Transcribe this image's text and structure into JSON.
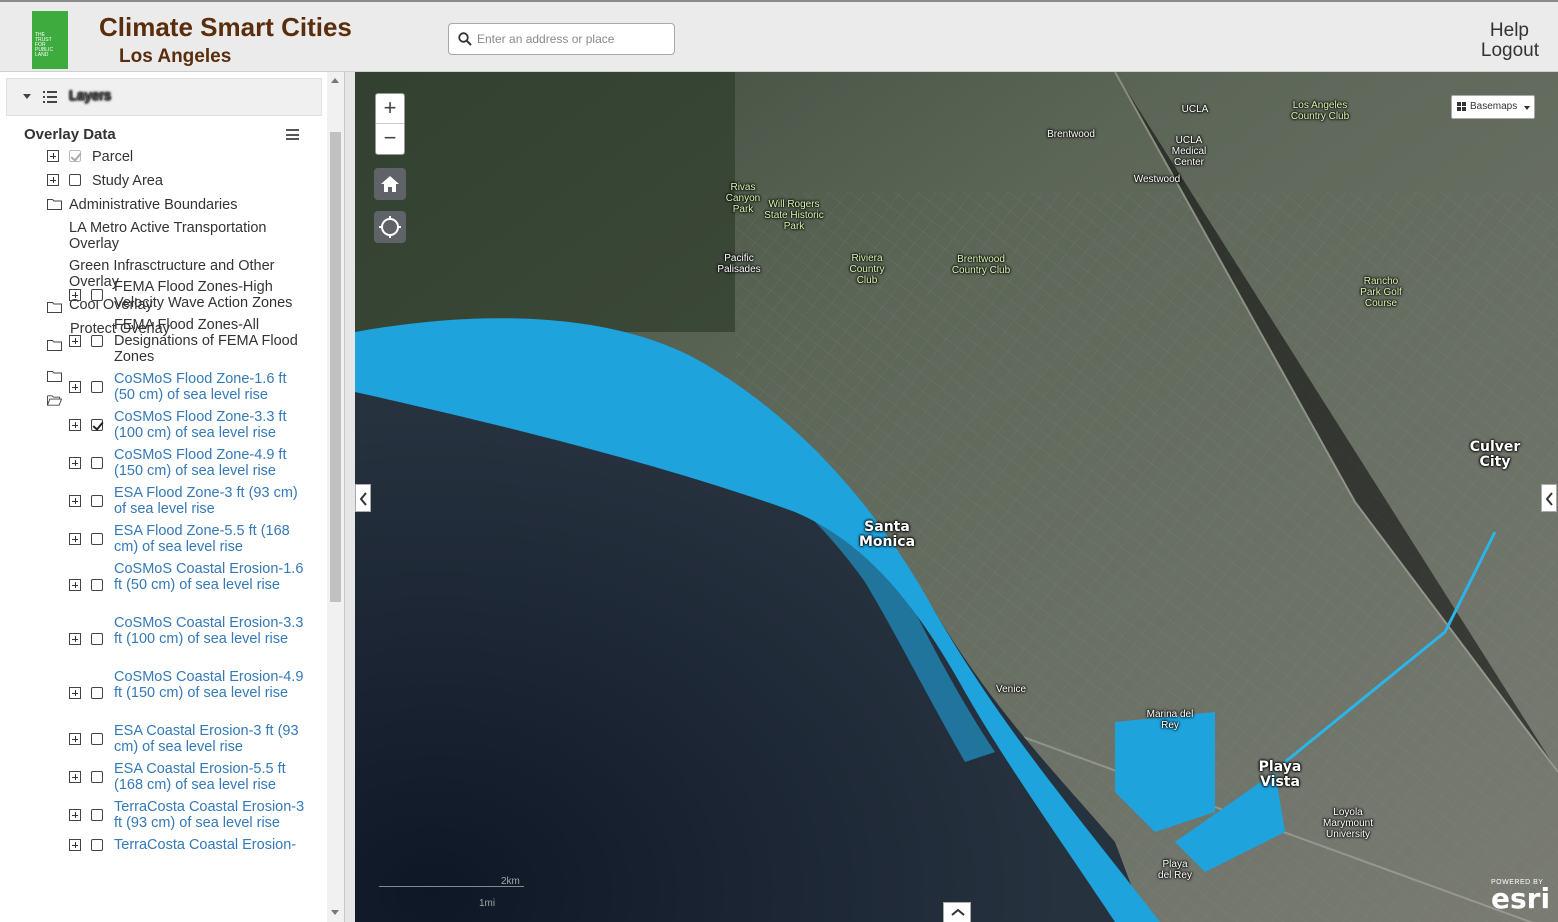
{
  "header": {
    "title": "Climate Smart Cities",
    "subtitle": "Los Angeles",
    "logo_text": [
      "THE",
      "TRUST",
      "FOR",
      "PUBLIC",
      "LAND"
    ],
    "search_placeholder": "Enter an address or place",
    "help": "Help",
    "logout": "Logout"
  },
  "sidebar": {
    "panel_title": "Layers",
    "overlay_title": "Overlay Data",
    "top_layers": [
      {
        "label": "Parcel",
        "checked": true
      },
      {
        "label": "Study Area",
        "checked": false
      }
    ],
    "folders": [
      "Administrative Boundaries",
      "LA Metro Active Transportation Overlay",
      "Green Infrasctructure and Other Overlay",
      "Cool Overlay",
      "Protect Overlay"
    ],
    "protect_layers": [
      {
        "label": "FEMA Flood Zones-High Velocity Wave Action Zones",
        "checked": false
      },
      {
        "label": "FEMA Flood Zones-All Designations of FEMA Flood Zones",
        "checked": false
      },
      {
        "label": "CoSMoS Flood Zone-1.6 ft (50 cm) of sea level rise",
        "checked": false
      },
      {
        "label": "CoSMoS Flood Zone-3.3 ft (100 cm) of sea level rise",
        "checked": true
      },
      {
        "label": "CoSMoS Flood Zone-4.9 ft (150 cm) of sea level rise",
        "checked": false
      },
      {
        "label": "ESA Flood Zone-3 ft (93 cm) of sea level rise",
        "checked": false
      },
      {
        "label": "ESA Flood Zone-5.5 ft (168 cm) of sea level rise",
        "checked": false
      },
      {
        "label": "CoSMoS Coastal Erosion-1.6 ft (50 cm) of sea level rise",
        "checked": false
      },
      {
        "label": "CoSMoS Coastal Erosion-3.3 ft (100 cm) of sea level rise",
        "checked": false
      },
      {
        "label": "CoSMoS Coastal Erosion-4.9 ft (150 cm) of sea level rise",
        "checked": false
      },
      {
        "label": "ESA Coastal Erosion-3 ft (93 cm) of sea level rise",
        "checked": false
      },
      {
        "label": "ESA Coastal Erosion-5.5 ft (168 cm) of sea level rise",
        "checked": false
      },
      {
        "label": "TerraCosta Coastal Erosion-3 ft (93 cm) of sea level rise",
        "checked": false
      },
      {
        "label": "TerraCosta Coastal Erosion-",
        "checked": false
      }
    ]
  },
  "map": {
    "zoom_in": "+",
    "zoom_out": "−",
    "basemaps": "Basemaps",
    "scale_km": "2km",
    "scale_mi": "1mi",
    "attribution_small": "POWERED BY",
    "attribution_brand": "esri",
    "place_labels": [
      "UCLA",
      "Los Angeles Country Club",
      "Brentwood",
      "UCLA Medical Center",
      "Westwood",
      "Rivas Canyon Park",
      "Will Rogers State Historic Park",
      "Pacific Palisades",
      "Riviera Country Club",
      "Brentwood Country Club",
      "Rancho Park Golf Course",
      "Culver City",
      "Santa Monica",
      "Venice",
      "Marina del Rey",
      "Playa Vista",
      "Loyola Marymount University",
      "Playa del Rey"
    ]
  }
}
